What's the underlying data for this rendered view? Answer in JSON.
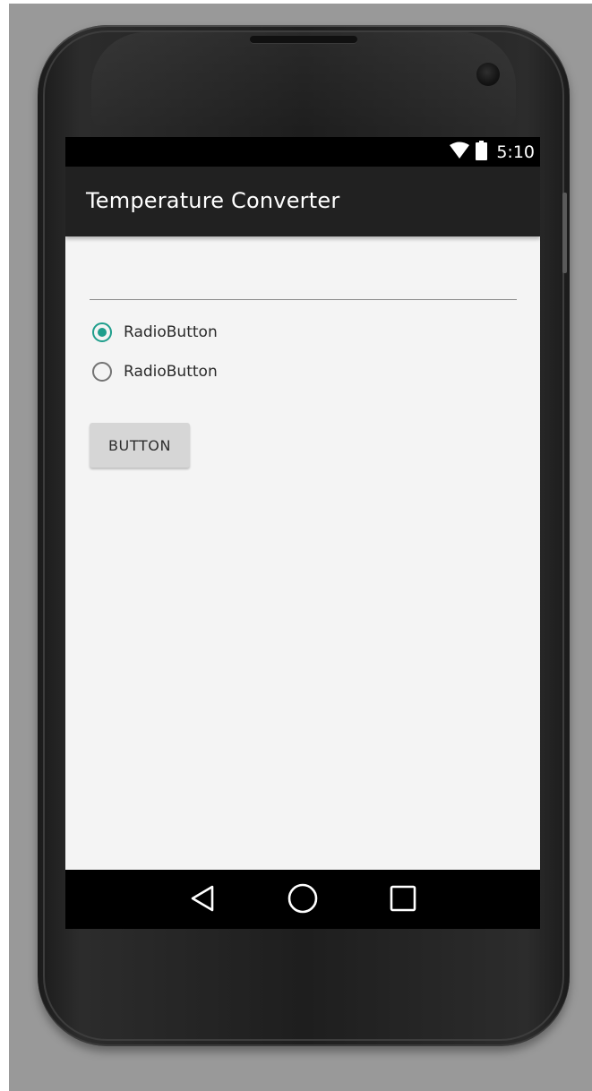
{
  "status_bar": {
    "time": "5:10",
    "icons": [
      "wifi-icon",
      "battery-icon"
    ]
  },
  "action_bar": {
    "title": "Temperature Converter"
  },
  "form": {
    "input_value": "",
    "radios": [
      {
        "label": "RadioButton",
        "checked": true
      },
      {
        "label": "RadioButton",
        "checked": false
      }
    ],
    "button_label": "BUTTON"
  },
  "navigation": {
    "buttons": [
      "back-icon",
      "home-icon",
      "recents-icon"
    ]
  },
  "colors": {
    "accent": "#1f9e8c",
    "action_bar": "#212121",
    "content_bg": "#f4f4f4",
    "button_bg": "#d6d6d6"
  }
}
